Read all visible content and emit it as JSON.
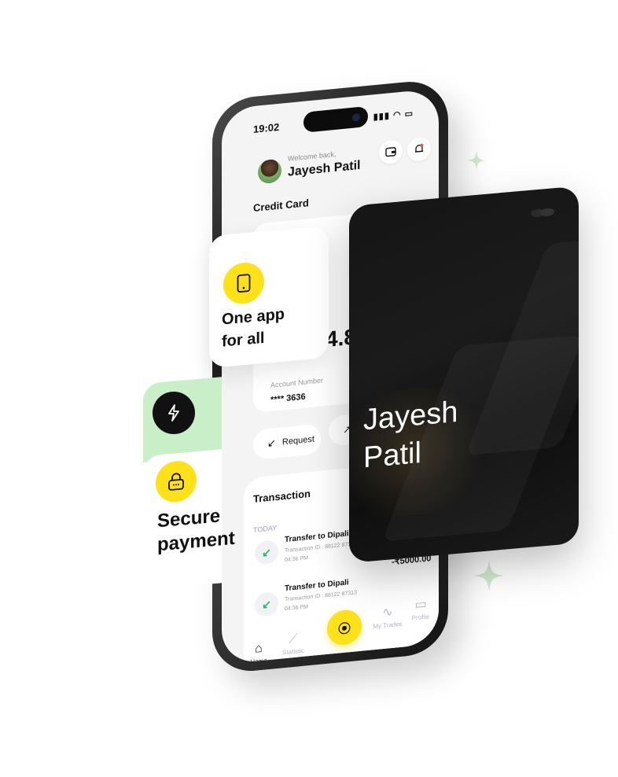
{
  "phone": {
    "status_time": "19:02",
    "welcome": "Welcome back,",
    "user_name": "Jayesh Patil",
    "credit_card_title": "Credit Card",
    "balance_partial": "4.8",
    "account_label": "Account Number",
    "account_number": "**** 3636",
    "request_label": "Request",
    "transaction_title": "Transaction",
    "today_label": "TODAY",
    "transactions": [
      {
        "title": "Transfer to Dipali",
        "sub": "Transaction ID : 88122 87313",
        "time": "04:36 PM",
        "amount": ""
      },
      {
        "title": "Transfer to Dipali",
        "sub": "Transaction ID : 88122 87313",
        "time": "04:36 PM",
        "amount": "-₹5000.00"
      }
    ],
    "nav": {
      "home": "Home",
      "statistic": "Statistic",
      "my_trades": "My Trades",
      "profile": "Profile"
    }
  },
  "feature_card": {
    "line1": "One app",
    "line2": "for all"
  },
  "secure_card": {
    "line1": "Secure",
    "line2": "payment"
  },
  "dark_card": {
    "first_name": "Jayesh",
    "last_name": "Patil"
  },
  "colors": {
    "accent_yellow": "#ffe11a",
    "accent_green": "#c9efc9",
    "card_dark": "#151515"
  },
  "icons": [
    "wallet-icon",
    "bell-icon",
    "phone-icon",
    "lightning-icon",
    "lock-icon",
    "scan-icon",
    "home-icon",
    "chart-icon",
    "pulse-icon",
    "card-icon",
    "arrow-down-left-icon"
  ]
}
